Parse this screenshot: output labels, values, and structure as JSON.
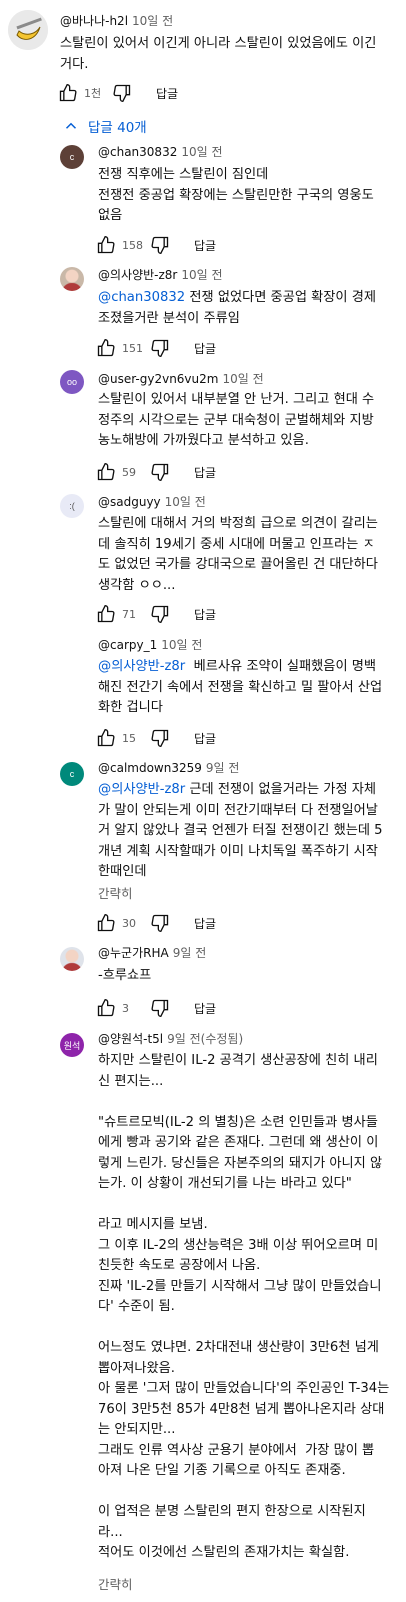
{
  "top_comment": {
    "author": "@바나나-h2l",
    "time": "10일 전",
    "text": "스탈린이 있어서 이긴게 아니라 스탈린이 있었음에도 이긴\n거다.",
    "likes": "1천",
    "reply_label": "답글"
  },
  "replies_toggle": {
    "label": "답글 40개",
    "icon": "chevron-up-icon"
  },
  "replies": [
    {
      "author": "@chan30832",
      "time": "10일 전",
      "avatar": {
        "letter": "c",
        "color": "#5d4037",
        "text_color": "#ffffff"
      },
      "text": "전쟁 직후에는 스탈린이 짐인데\n전쟁전 중공업 확장에는 스탈린만한 구국의 영웅도\n없음",
      "likes": "158",
      "reply_label": "답글"
    },
    {
      "author": "@의사양반-z8r",
      "time": "10일 전",
      "avatar": {
        "letter": "",
        "color": "#c9b8a8",
        "text_color": "#ffffff",
        "icon": "photo-avatar-icon"
      },
      "mention": "@chan30832",
      "text": " 전쟁 없었다면 중공업 확장이 경제\n조졌을거란 분석이 주류임",
      "likes": "151",
      "reply_label": "답글"
    },
    {
      "author": "@user-gy2vn6vu2m",
      "time": "10일 전",
      "avatar": {
        "letter": "oo",
        "color": "#7e57c2",
        "text_color": "#ffffff"
      },
      "text": "스탈린이 있어서 내부분열 안 난거. 그리고 현대 수\n정주의 시각으로는 군부 대숙청이 군벌해체와 지방\n농노해방에 가까웠다고 분석하고 있음.",
      "likes": "59",
      "reply_label": "답글"
    },
    {
      "author": "@sadguyy",
      "time": "10일 전",
      "avatar": {
        "letter": ":(",
        "color": "#e8eaf6",
        "text_color": "#555555"
      },
      "text": "스탈린에 대해서 거의 박정희 급으로 의견이 갈리는\n데 솔직히 19세기 중세 시대에 머물고 인프라는 ㅈ\n도 없었던 국가를 강대국으로 끌어올린 건 대단하다\n생각함 ㅇㅇ...",
      "likes": "71",
      "reply_label": "답글"
    },
    {
      "author": "@carpy_1",
      "time": "10일 전",
      "avatar": null,
      "mention": "@의사양반-z8r",
      "text": "  베르사유 조약이 실패했음이 명백\n해진 전간기 속에서 전쟁을 확신하고 밀 팔아서 산업\n화한 겁니다",
      "likes": "15",
      "reply_label": "답글"
    },
    {
      "author": "@calmdown3259",
      "time": "9일 전",
      "avatar": {
        "letter": "c",
        "color": "#00897b",
        "text_color": "#ffffff"
      },
      "mention": "@의사양반-z8r",
      "text": " 근데 전쟁이 없을거라는 가정 자체\n가 말이 안되는게 이미 전간기때부터 다 전쟁일어날\n거 알지 않았나 결국 언젠가 터질 전쟁이긴 했는데 5\n개년 계획 시작할때가 이미 나치독일 폭주하기 시작\n한때인데",
      "more": "간략히",
      "likes": "30",
      "reply_label": "답글"
    },
    {
      "author": "@누군가RHA",
      "time": "9일 전",
      "avatar": {
        "letter": "",
        "color": "#dfe3ea",
        "text_color": "#ffffff",
        "icon": "cartoon-avatar-icon"
      },
      "text": "-흐루쇼프",
      "likes": "3",
      "reply_label": "답글"
    },
    {
      "author": "@양원석-t5l",
      "time": "9일 전(수정됨)",
      "avatar": {
        "letter": "원석",
        "color": "#8e24aa",
        "text_color": "#ffffff"
      },
      "text": "하지만 스탈린이 IL-2 공격기 생산공장에 친히 내리\n신 편지는...\n\n\"슈트르모빅(IL-2 의 별칭)은 소련 인민들과 병사들\n에게 빵과 공기와 같은 존재다. 그런데 왜 생산이 이\n렇게 느린가. 당신들은 자본주의의 돼지가 아니지 않\n는가. 이 상황이 개선되기를 나는 바라고 있다\"\n\n라고 메시지를 보냄.\n그 이후 IL-2의 생산능력은 3배 이상 뛰어오르며 미\n친듯한 속도로 공장에서 나옴.\n진짜 'IL-2를 만들기 시작해서 그냥 많이 만들었습니\n다' 수준이 됨.\n\n어느정도 였냐면. 2차대전내 생산량이 3만6천 넘게\n뽑아져나왔음.\n아 물론 '그저 많이 만들었습니다'의 주인공인 T-34는\n76이 3만5천 85가 4만8천 넘게 뽑아나온지라 상대\n는 안되지만...\n그래도 인류 역사상 군용기 분야에서  가장 많이 뽑\n아져 나온 단일 기종 기록으로 아직도 존재중.\n\n이 업적은 분명 스탈린의 편지 한장으로 시작된지\n라...\n적어도 이것에선 스탈린의 존재가치는 확실함.",
      "more": "간략히"
    }
  ],
  "colors": {
    "accent": "#065fd4",
    "meta": "#606060",
    "text": "#0f0f0f"
  }
}
